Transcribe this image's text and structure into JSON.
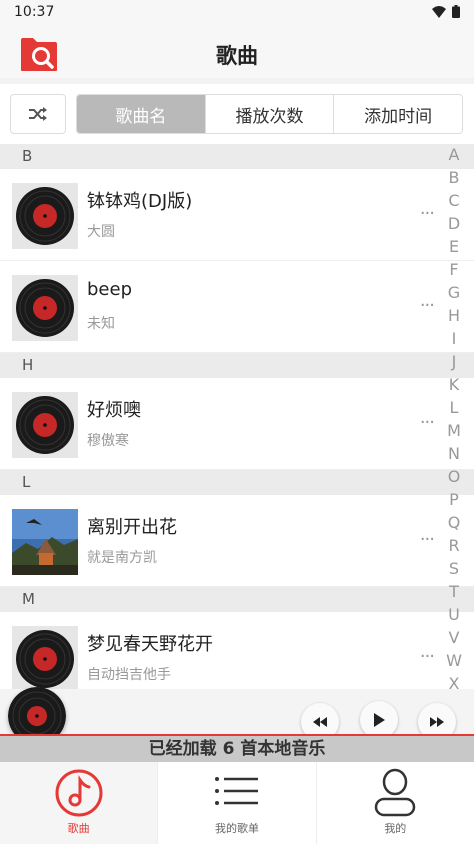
{
  "status_bar": {
    "time": "10:37"
  },
  "header": {
    "title": "歌曲"
  },
  "sort": {
    "tabs": [
      {
        "label": "歌曲名",
        "active": true
      },
      {
        "label": "播放次数",
        "active": false
      },
      {
        "label": "添加时间",
        "active": false
      }
    ]
  },
  "list": {
    "sections": [
      {
        "letter": "B",
        "songs": [
          {
            "title": "钵钵鸡(DJ版)",
            "artist": "大圆",
            "cover": "vinyl-icon"
          },
          {
            "title": "beep",
            "artist": "未知",
            "cover": "vinyl-icon"
          }
        ]
      },
      {
        "letter": "H",
        "songs": [
          {
            "title": "好烦噢",
            "artist": "穆傲寒",
            "cover": "vinyl-icon"
          }
        ]
      },
      {
        "letter": "L",
        "songs": [
          {
            "title": "离别开出花",
            "artist": "就是南方凯",
            "cover": "album-photo"
          }
        ]
      },
      {
        "letter": "M",
        "songs": [
          {
            "title": "梦见春天野花开",
            "artist": "自动挡吉他手",
            "cover": "vinyl-icon"
          }
        ]
      }
    ],
    "more_glyph": "···"
  },
  "alpha_index": [
    "A",
    "B",
    "C",
    "D",
    "E",
    "F",
    "G",
    "H",
    "I",
    "J",
    "K",
    "L",
    "M",
    "N",
    "O",
    "P",
    "Q",
    "R",
    "S",
    "T",
    "U",
    "V",
    "W",
    "X"
  ],
  "player": {
    "status_text": "已经加载  6 首本地音乐"
  },
  "nav": {
    "items": [
      {
        "label": "歌曲",
        "icon": "music-note-icon",
        "active": true
      },
      {
        "label": "我的歌单",
        "icon": "playlist-icon",
        "active": false
      },
      {
        "label": "我的",
        "icon": "profile-icon",
        "active": false
      }
    ]
  },
  "colors": {
    "accent": "#e53935",
    "active_tab": "#b9b9b9"
  }
}
